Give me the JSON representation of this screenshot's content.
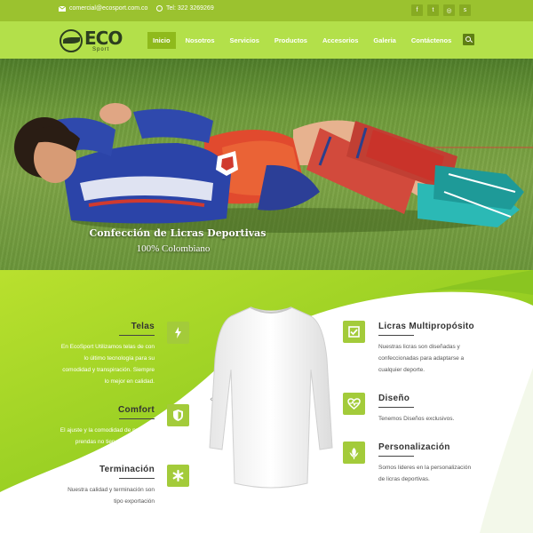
{
  "topbar": {
    "email": "comercial@ecosport.com.co",
    "phone": "Tel: 322 3269269",
    "socials": [
      "f",
      "t",
      "ig",
      "s"
    ]
  },
  "logo": {
    "name": "ECO",
    "sub": "Sport"
  },
  "menu": [
    "Inicio",
    "Nosotros",
    "Servicios",
    "Productos",
    "Accesorios",
    "Galeria",
    "Contáctenos"
  ],
  "hero": {
    "title": "Confección de Licras Deportivas",
    "subtitle": "100% Colombiano"
  },
  "features_left": [
    {
      "title": "Telas",
      "icon": "bolt-icon",
      "text": "En EcoSport Utilizamos telas de con lo último tecnología para su comodidad y transpiración. Siempre lo mejor en calidad."
    },
    {
      "title": "Comfort",
      "icon": "shield-icon",
      "text": "El ajuste y la comodidad de nuestras prendas no tiene comparación."
    },
    {
      "title": "Terminación",
      "icon": "asterisk-icon",
      "text": "Nuestra calidad y terminación son tipo exportación"
    }
  ],
  "features_right": [
    {
      "title": "Licras Multipropósito",
      "icon": "check-icon",
      "text": "Nuestras licras son diseñadas y confeccionadas para adaptarse a cualquier deporte."
    },
    {
      "title": "Diseño",
      "icon": "heartbeat-icon",
      "text": "Tenemos Diseños exclusivos."
    },
    {
      "title": "Personalización",
      "icon": "leaf-icon",
      "text": "Somos lideres en la personalización de licras deportivas."
    }
  ],
  "colors": {
    "accent": "#9bc22f",
    "nav": "#b3e04a",
    "active": "#8fba1c"
  }
}
